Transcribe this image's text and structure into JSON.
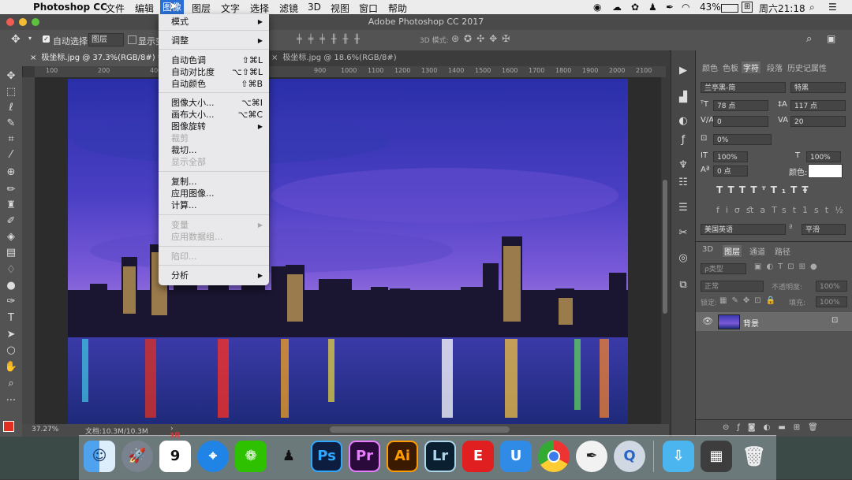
{
  "menubar": {
    "app_name": "Photoshop CC",
    "items": [
      "文件",
      "编辑",
      "图像",
      "图层",
      "文字",
      "选择",
      "滤镜",
      "3D",
      "视图",
      "窗口",
      "帮助"
    ],
    "active_item": "图像",
    "battery": "43%",
    "clock": "周六21:18"
  },
  "window": {
    "title": "Adobe Photoshop CC 2017"
  },
  "options_bar": {
    "auto_select_label": "自动选择:",
    "auto_select_value": "图层",
    "show_transform_label": "显示变",
    "mode_3d": "3D 模式:"
  },
  "tabs": [
    {
      "label": "极坐标.jpg @ 37.3%(RGB/8#) *",
      "active": true
    },
    {
      "label": "极坐标.jpg @ 18.6%(RGB/8#)",
      "active": false
    }
  ],
  "ruler": {
    "ticks": [
      "100",
      "100",
      "200",
      "300",
      "400",
      "500",
      "600",
      "700",
      "800",
      "900",
      "1000",
      "1100",
      "1200",
      "1300",
      "1400",
      "1500",
      "1600",
      "1700",
      "1800",
      "1900",
      "2000",
      "2100"
    ]
  },
  "status": {
    "zoom": "37.27%",
    "doc": "文档:10.3M/10.3M"
  },
  "image_menu": {
    "items": [
      {
        "label": "模式",
        "submenu": true
      },
      {
        "label": "调整",
        "submenu": true
      },
      {
        "label": "自动色调",
        "shortcut": "⇧⌘L"
      },
      {
        "label": "自动对比度",
        "shortcut": "⌥⇧⌘L"
      },
      {
        "label": "自动颜色",
        "shortcut": "⇧⌘B"
      },
      {
        "label": "图像大小...",
        "shortcut": "⌥⌘I"
      },
      {
        "label": "画布大小...",
        "shortcut": "⌥⌘C"
      },
      {
        "label": "图像旋转",
        "submenu": true
      },
      {
        "label": "裁剪",
        "disabled": true
      },
      {
        "label": "裁切..."
      },
      {
        "label": "显示全部",
        "disabled": true
      },
      {
        "label": "复制..."
      },
      {
        "label": "应用图像..."
      },
      {
        "label": "计算..."
      },
      {
        "label": "变量",
        "submenu": true,
        "disabled": true
      },
      {
        "label": "应用数据组...",
        "disabled": true
      },
      {
        "label": "陷印...",
        "disabled": true
      },
      {
        "label": "分析",
        "submenu": true
      }
    ]
  },
  "char_panel": {
    "tabs": [
      "颜色",
      "色板",
      "字符",
      "段落",
      "历史记",
      "属性"
    ],
    "active_tab": "字符",
    "font_family": "兰亭黑-简",
    "font_style": "特黑",
    "size": "78 点",
    "leading": "117 点",
    "kerning": "0",
    "tracking": "20",
    "vscale_pct": "0%",
    "vertical_scale": "100%",
    "horizontal_scale": "100%",
    "baseline": "0 点",
    "color_label": "颜色:",
    "language": "美国英语",
    "antialias": "平滑"
  },
  "layers_panel": {
    "tabs": [
      "3D",
      "图层",
      "通道",
      "路径"
    ],
    "active_tab": "图层",
    "kind_placeholder": "ρ类型",
    "blend_mode": "正常",
    "opacity_label": "不透明度:",
    "opacity": "100%",
    "lock_label": "锁定:",
    "fill_label": "填充:",
    "fill": "100%",
    "layer_name": "背景"
  },
  "dock": {
    "calendar_day": "9",
    "calendar_month": "3月",
    "apps": [
      "Finder",
      "Launchpad",
      "Calendar",
      "Safari",
      "WeChat",
      "QQ",
      "Ps",
      "Pr",
      "Ai",
      "Lr",
      "E",
      "U",
      "Chrome",
      "Pen",
      "QuickTime",
      "Folder",
      "Preview",
      "Trash"
    ]
  },
  "colors": {
    "accent": "#2a6fd6",
    "foreground": "#e22d21",
    "background": "#ffffff"
  }
}
